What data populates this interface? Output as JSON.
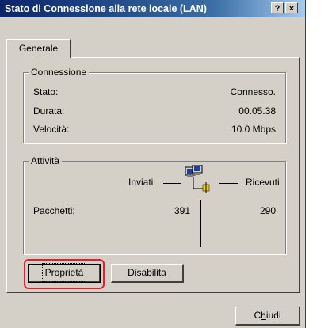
{
  "window": {
    "title": "Stato di Connessione alla rete locale (LAN)",
    "help_label": "?",
    "close_label": "×"
  },
  "tabs": [
    {
      "label": "Generale"
    }
  ],
  "connection": {
    "group_title": "Connessione",
    "rows": [
      {
        "label": "Stato:",
        "value": "Connesso."
      },
      {
        "label": "Durata:",
        "value": "00.05.38"
      },
      {
        "label": "Velocità:",
        "value": "10.0 Mbps"
      }
    ]
  },
  "activity": {
    "group_title": "Attività",
    "sent_label": "Inviati",
    "received_label": "Ricevuti",
    "packets_label": "Pacchetti:",
    "packets_sent": "391",
    "packets_received": "290",
    "icon": "network-computers-icon"
  },
  "buttons": {
    "properties": {
      "first": "P",
      "rest": "roprietà"
    },
    "disable": {
      "first": "D",
      "rest": "isabilita"
    },
    "close": {
      "pre": "C",
      "ul": "h",
      "rest": "iudi"
    }
  },
  "colors": {
    "title_bar_start": "#0a246a",
    "title_bar_end": "#a6caf0",
    "dialog_bg": "#d4d0c8",
    "highlight": "#e0202a"
  }
}
